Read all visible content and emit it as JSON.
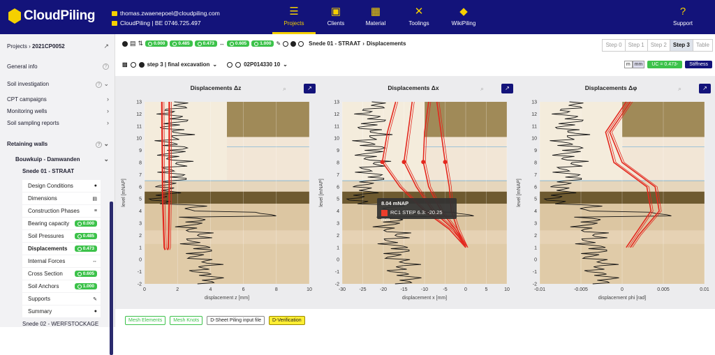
{
  "topbar": {
    "brand": "CloudPiling",
    "email": "thomas.zwaenepoel@cloudpiling.com",
    "company": "CloudPiling | BE 0746.725.497",
    "nav": [
      {
        "label": "Projects",
        "icon": "list-icon",
        "active": true
      },
      {
        "label": "Clients",
        "icon": "briefcase-icon",
        "active": false
      },
      {
        "label": "Material",
        "icon": "bricks-icon",
        "active": false
      },
      {
        "label": "Toolings",
        "icon": "tools-icon",
        "active": false
      },
      {
        "label": "WikiPiling",
        "icon": "graduation-cap-icon",
        "active": false
      },
      {
        "label": "Support",
        "icon": "question-icon",
        "active": false
      }
    ]
  },
  "sidebar": {
    "breadcrumb_projects": "Projects",
    "breadcrumb_sep": "›",
    "project_id": "2021CP0052",
    "general_info": "General info",
    "soil_investigation": "Soil investigation",
    "cpt_campaigns": "CPT campaigns",
    "monitoring_wells": "Monitoring wells",
    "soil_sampling_reports": "Soil sampling reports",
    "retaining_walls": "Retaining walls",
    "wall": "Bouwkuip - Damwanden",
    "section": "Snede 01 - STRAAT",
    "items": [
      {
        "label": "Design Conditions",
        "icon": "dot-icon",
        "badge": ""
      },
      {
        "label": "Dimensions",
        "icon": "table-icon",
        "badge": ""
      },
      {
        "label": "Construction Phases",
        "icon": "phases-icon",
        "badge": ""
      },
      {
        "label": "Bearing capacity",
        "icon": "",
        "badge": "0.000"
      },
      {
        "label": "Soil Pressures",
        "icon": "",
        "badge": "0.485"
      },
      {
        "label": "Displacements",
        "icon": "",
        "badge": "0.473"
      },
      {
        "label": "Internal Forces",
        "icon": "arrows-icon",
        "badge": ""
      },
      {
        "label": "Cross Section",
        "icon": "",
        "badge": "0.605"
      },
      {
        "label": "Soil Anchors",
        "icon": "",
        "badge": "1.000"
      },
      {
        "label": "Supports",
        "icon": "paperclip-icon",
        "badge": ""
      },
      {
        "label": "Summary",
        "icon": "dot-icon",
        "badge": ""
      }
    ],
    "section2": "Snede 02 - WERFSTOCKAGE"
  },
  "toolbar": {
    "badges": [
      "0.000",
      "0.485",
      "0.473",
      "0.605",
      "1.000"
    ],
    "breadcrumb_section": "Snede 01 - STRAAT",
    "breadcrumb_sep": "›",
    "breadcrumb_page": "Displacements",
    "steps": [
      "Step 0",
      "Step 1",
      "Step 2",
      "Step 3",
      "Table"
    ],
    "active_step": "Step 3"
  },
  "subbar": {
    "step_select": "step 3 | final excavation",
    "cpt_select": "02P014330 10",
    "unit_m": "m",
    "unit_mm": "mm",
    "uc_label": "UC = 0.473-",
    "stiffness": "Stiffness"
  },
  "tooltip": {
    "level": "8.04 mNAP",
    "series": "RC1 STEP 6.3: -20.25 mm"
  },
  "bottom": {
    "mesh_elements": "Mesh Elements",
    "mesh_knots": "Mesh Knots",
    "dsheet": "D-Sheet Piling input file",
    "dverification": "D-Verification"
  },
  "colors": {
    "navy": "#13137a",
    "yellow": "#f5d000",
    "green": "#3cc24a",
    "red": "#e3281e"
  },
  "chart_data": [
    {
      "type": "line",
      "title": "Displacements Δz",
      "xlabel": "displacement z [mm]",
      "ylabel": "level [mNAP]",
      "xlim": [
        0,
        10
      ],
      "ylim": [
        -2,
        13
      ],
      "xticks": [
        0,
        2,
        4,
        6,
        8,
        10
      ],
      "yticks": [
        -2,
        -1,
        0,
        1,
        2,
        3,
        4,
        5,
        6,
        7,
        8,
        9,
        10,
        11,
        12,
        13
      ],
      "series": [
        {
          "points": [
            [
              1.05,
              13
            ],
            [
              1.1,
              5
            ],
            [
              1.2,
              1
            ],
            [
              1.25,
              0.8
            ]
          ]
        },
        {
          "points": [
            [
              1.5,
              13
            ],
            [
              1.5,
              5
            ],
            [
              1.45,
              1
            ],
            [
              1.4,
              0.8
            ]
          ]
        }
      ]
    },
    {
      "type": "line",
      "title": "Displacements Δx",
      "xlabel": "displacement x [mm]",
      "ylabel": "level [mNAP]",
      "xlim": [
        -30,
        10
      ],
      "ylim": [
        -2,
        13
      ],
      "xticks": [
        -30,
        -25,
        -20,
        -15,
        -10,
        -5,
        0,
        5,
        10
      ],
      "yticks": [
        -2,
        -1,
        0,
        1,
        2,
        3,
        4,
        5,
        6,
        7,
        8,
        9,
        10,
        11,
        12,
        13
      ],
      "series": [
        {
          "name": "RC1 STEP 6.3",
          "points": [
            [
              -17,
              13
            ],
            [
              -19,
              10.5
            ],
            [
              -20.25,
              8.04
            ],
            [
              -16,
              6
            ],
            [
              -10,
              4
            ],
            [
              -4,
              2.5
            ],
            [
              0,
              1
            ]
          ]
        },
        {
          "points": [
            [
              -13,
              13
            ],
            [
              -14,
              10.5
            ],
            [
              -15,
              8.04
            ],
            [
              -12,
              6
            ],
            [
              -8,
              4
            ],
            [
              -3,
              2.5
            ],
            [
              0,
              1
            ]
          ]
        },
        {
          "points": [
            [
              -9,
              13
            ],
            [
              -10,
              10.5
            ],
            [
              -10.3,
              8.04
            ],
            [
              -9,
              6
            ],
            [
              -6,
              4
            ],
            [
              -2.5,
              2.5
            ],
            [
              0,
              1
            ]
          ]
        },
        {
          "points": [
            [
              -7,
              13
            ],
            [
              -6,
              10.5
            ],
            [
              -5,
              8.04
            ],
            [
              -4,
              6
            ],
            [
              -3.5,
              4
            ],
            [
              -2,
              2.5
            ],
            [
              0,
              1
            ]
          ]
        }
      ]
    },
    {
      "type": "line",
      "title": "Displacements Δφ",
      "xlabel": "displacement phi [rad]",
      "ylabel": "level [mNAP]",
      "xlim": [
        -0.01,
        0.01
      ],
      "ylim": [
        -2,
        13
      ],
      "xticks": [
        -0.01,
        -0.005,
        0,
        0.005,
        0.01
      ],
      "yticks": [
        -2,
        -1,
        0,
        1,
        2,
        3,
        4,
        5,
        6,
        7,
        8,
        9,
        10,
        11,
        12,
        13
      ],
      "series": [
        {
          "points": [
            [
              0.0005,
              13
            ],
            [
              -0.002,
              10.5
            ],
            [
              -0.001,
              8
            ],
            [
              0.003,
              6
            ],
            [
              0.0035,
              4
            ],
            [
              0.0015,
              2
            ],
            [
              0.0005,
              1
            ]
          ]
        },
        {
          "points": [
            [
              0.001,
              13
            ],
            [
              -0.0015,
              10.5
            ],
            [
              0,
              8
            ],
            [
              0.004,
              6
            ],
            [
              0.0045,
              4
            ],
            [
              0.002,
              2
            ],
            [
              0.001,
              1
            ]
          ]
        }
      ]
    }
  ]
}
